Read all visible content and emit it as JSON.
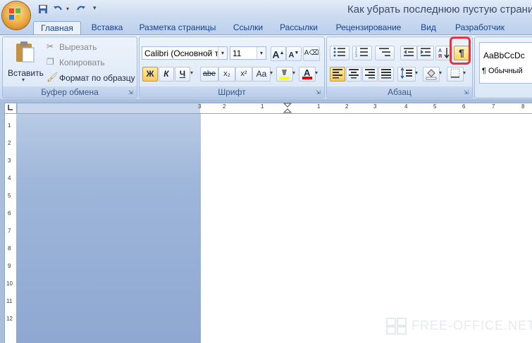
{
  "window": {
    "title": "Как убрать последнюю пустую страни"
  },
  "tabs": [
    "Главная",
    "Вставка",
    "Разметка страницы",
    "Ссылки",
    "Рассылки",
    "Рецензирование",
    "Вид",
    "Разработчик"
  ],
  "clipboard": {
    "paste_label": "Вставить",
    "cut_label": "Вырезать",
    "copy_label": "Копировать",
    "format_painter_label": "Формат по образцу",
    "group_label": "Буфер обмена"
  },
  "font": {
    "font_name": "Calibri (Основной те",
    "font_size": "11",
    "bold": "Ж",
    "italic": "К",
    "underline": "Ч",
    "strike": "abe",
    "subscript": "x₂",
    "superscript": "x²",
    "case": "Aa",
    "grow": "A",
    "shrink": "A",
    "group_label": "Шрифт"
  },
  "paragraph": {
    "group_label": "Абзац",
    "pilcrow": "¶"
  },
  "styles": {
    "sample": "AaBbCcDc",
    "name": "¶ Обычный"
  },
  "ruler": {
    "h_ticks": [
      "3",
      "2",
      "1",
      "1",
      "2",
      "3",
      "4",
      "5",
      "6",
      "7",
      "8"
    ],
    "v_ticks": [
      "1",
      "2",
      "3",
      "4",
      "5",
      "6",
      "7",
      "8",
      "9",
      "10",
      "11",
      "12"
    ]
  },
  "watermark": "FREE-OFFICE.NET",
  "colors": {
    "accent": "#15428b",
    "highlight": "#e8323c",
    "font_color": "#e00000",
    "marker": "#ffff00"
  }
}
